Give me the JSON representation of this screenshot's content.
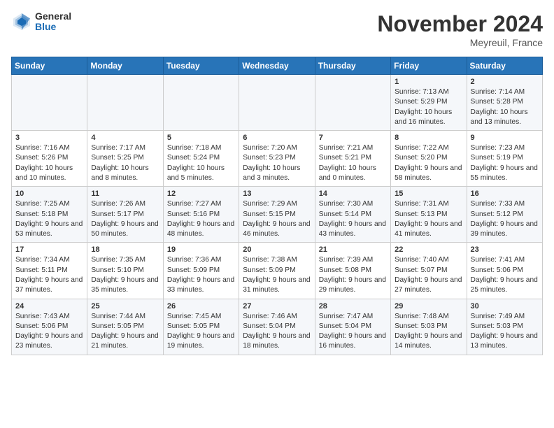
{
  "header": {
    "logo_general": "General",
    "logo_blue": "Blue",
    "month_title": "November 2024",
    "location": "Meyreuil, France"
  },
  "weekdays": [
    "Sunday",
    "Monday",
    "Tuesday",
    "Wednesday",
    "Thursday",
    "Friday",
    "Saturday"
  ],
  "weeks": [
    [
      {
        "day": "",
        "info": ""
      },
      {
        "day": "",
        "info": ""
      },
      {
        "day": "",
        "info": ""
      },
      {
        "day": "",
        "info": ""
      },
      {
        "day": "",
        "info": ""
      },
      {
        "day": "1",
        "info": "Sunrise: 7:13 AM\nSunset: 5:29 PM\nDaylight: 10 hours and 16 minutes."
      },
      {
        "day": "2",
        "info": "Sunrise: 7:14 AM\nSunset: 5:28 PM\nDaylight: 10 hours and 13 minutes."
      }
    ],
    [
      {
        "day": "3",
        "info": "Sunrise: 7:16 AM\nSunset: 5:26 PM\nDaylight: 10 hours and 10 minutes."
      },
      {
        "day": "4",
        "info": "Sunrise: 7:17 AM\nSunset: 5:25 PM\nDaylight: 10 hours and 8 minutes."
      },
      {
        "day": "5",
        "info": "Sunrise: 7:18 AM\nSunset: 5:24 PM\nDaylight: 10 hours and 5 minutes."
      },
      {
        "day": "6",
        "info": "Sunrise: 7:20 AM\nSunset: 5:23 PM\nDaylight: 10 hours and 3 minutes."
      },
      {
        "day": "7",
        "info": "Sunrise: 7:21 AM\nSunset: 5:21 PM\nDaylight: 10 hours and 0 minutes."
      },
      {
        "day": "8",
        "info": "Sunrise: 7:22 AM\nSunset: 5:20 PM\nDaylight: 9 hours and 58 minutes."
      },
      {
        "day": "9",
        "info": "Sunrise: 7:23 AM\nSunset: 5:19 PM\nDaylight: 9 hours and 55 minutes."
      }
    ],
    [
      {
        "day": "10",
        "info": "Sunrise: 7:25 AM\nSunset: 5:18 PM\nDaylight: 9 hours and 53 minutes."
      },
      {
        "day": "11",
        "info": "Sunrise: 7:26 AM\nSunset: 5:17 PM\nDaylight: 9 hours and 50 minutes."
      },
      {
        "day": "12",
        "info": "Sunrise: 7:27 AM\nSunset: 5:16 PM\nDaylight: 9 hours and 48 minutes."
      },
      {
        "day": "13",
        "info": "Sunrise: 7:29 AM\nSunset: 5:15 PM\nDaylight: 9 hours and 46 minutes."
      },
      {
        "day": "14",
        "info": "Sunrise: 7:30 AM\nSunset: 5:14 PM\nDaylight: 9 hours and 43 minutes."
      },
      {
        "day": "15",
        "info": "Sunrise: 7:31 AM\nSunset: 5:13 PM\nDaylight: 9 hours and 41 minutes."
      },
      {
        "day": "16",
        "info": "Sunrise: 7:33 AM\nSunset: 5:12 PM\nDaylight: 9 hours and 39 minutes."
      }
    ],
    [
      {
        "day": "17",
        "info": "Sunrise: 7:34 AM\nSunset: 5:11 PM\nDaylight: 9 hours and 37 minutes."
      },
      {
        "day": "18",
        "info": "Sunrise: 7:35 AM\nSunset: 5:10 PM\nDaylight: 9 hours and 35 minutes."
      },
      {
        "day": "19",
        "info": "Sunrise: 7:36 AM\nSunset: 5:09 PM\nDaylight: 9 hours and 33 minutes."
      },
      {
        "day": "20",
        "info": "Sunrise: 7:38 AM\nSunset: 5:09 PM\nDaylight: 9 hours and 31 minutes."
      },
      {
        "day": "21",
        "info": "Sunrise: 7:39 AM\nSunset: 5:08 PM\nDaylight: 9 hours and 29 minutes."
      },
      {
        "day": "22",
        "info": "Sunrise: 7:40 AM\nSunset: 5:07 PM\nDaylight: 9 hours and 27 minutes."
      },
      {
        "day": "23",
        "info": "Sunrise: 7:41 AM\nSunset: 5:06 PM\nDaylight: 9 hours and 25 minutes."
      }
    ],
    [
      {
        "day": "24",
        "info": "Sunrise: 7:43 AM\nSunset: 5:06 PM\nDaylight: 9 hours and 23 minutes."
      },
      {
        "day": "25",
        "info": "Sunrise: 7:44 AM\nSunset: 5:05 PM\nDaylight: 9 hours and 21 minutes."
      },
      {
        "day": "26",
        "info": "Sunrise: 7:45 AM\nSunset: 5:05 PM\nDaylight: 9 hours and 19 minutes."
      },
      {
        "day": "27",
        "info": "Sunrise: 7:46 AM\nSunset: 5:04 PM\nDaylight: 9 hours and 18 minutes."
      },
      {
        "day": "28",
        "info": "Sunrise: 7:47 AM\nSunset: 5:04 PM\nDaylight: 9 hours and 16 minutes."
      },
      {
        "day": "29",
        "info": "Sunrise: 7:48 AM\nSunset: 5:03 PM\nDaylight: 9 hours and 14 minutes."
      },
      {
        "day": "30",
        "info": "Sunrise: 7:49 AM\nSunset: 5:03 PM\nDaylight: 9 hours and 13 minutes."
      }
    ]
  ]
}
